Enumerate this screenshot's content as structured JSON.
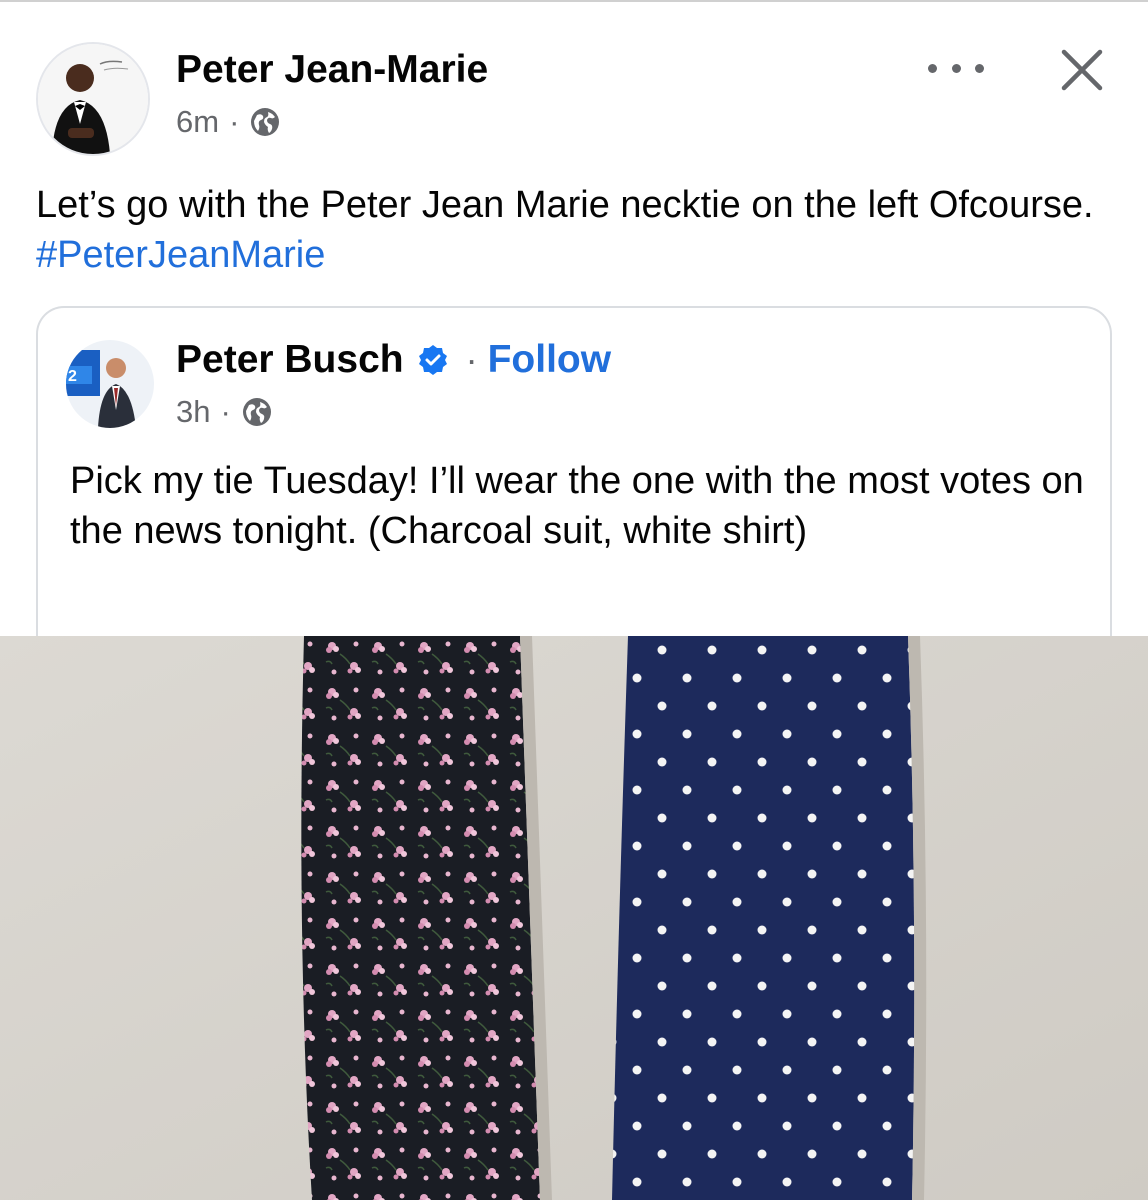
{
  "post": {
    "author_name": "Peter Jean-Marie",
    "timestamp": "6m",
    "meta_separator": "·",
    "privacy_icon": "globe-icon",
    "more_icon": "more-horizontal-icon",
    "close_icon": "close-icon",
    "text_main": "Let’s go with the Peter Jean Marie necktie on the left Ofcourse. ",
    "hashtag": "#PeterJeanMarie"
  },
  "shared": {
    "author_name": "Peter Busch",
    "verified_icon": "verified-badge-icon",
    "separator": "·",
    "follow_label": "Follow",
    "timestamp": "3h",
    "meta_separator": "·",
    "privacy_icon": "globe-icon",
    "text": "Pick my tie Tuesday! I’ll wear the one with the most votes on the news tonight. (Charcoal suit, white shirt)"
  },
  "colors": {
    "link_blue": "#216fdb",
    "secondary_text": "#65676b",
    "primary_text": "#050505",
    "tie_left": "#1a1d24",
    "tie_left_flowers": "#e2a6c4",
    "tie_right": "#1d2a5c",
    "tie_right_dots": "#f4f4f4"
  }
}
